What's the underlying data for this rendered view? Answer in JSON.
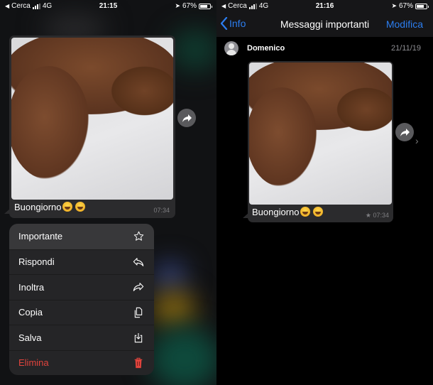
{
  "left": {
    "statusbar": {
      "carrier": "Cerca",
      "network": "4G",
      "time": "21:15",
      "battery": "67%"
    },
    "message": {
      "caption": "Buongiorno",
      "time": "07:34",
      "image": "croissant-photo"
    },
    "context_menu": {
      "items": [
        {
          "label": "Importante",
          "icon": "star-icon"
        },
        {
          "label": "Rispondi",
          "icon": "reply-icon"
        },
        {
          "label": "Inoltra",
          "icon": "forward-icon"
        },
        {
          "label": "Copia",
          "icon": "copy-icon"
        },
        {
          "label": "Salva",
          "icon": "save-icon"
        },
        {
          "label": "Elimina",
          "icon": "trash-icon",
          "destructive": true
        }
      ]
    }
  },
  "right": {
    "statusbar": {
      "carrier": "Cerca",
      "network": "4G",
      "time": "21:16",
      "battery": "67%"
    },
    "navbar": {
      "back_label": "Info",
      "title": "Messaggi importanti",
      "edit_label": "Modifica"
    },
    "sender": {
      "name": "Domenico",
      "date": "21/11/19"
    },
    "message": {
      "caption": "Buongiorno",
      "time": "07:34",
      "starred": true,
      "image": "croissant-photo"
    }
  },
  "colors": {
    "accent": "#2c7ef0",
    "destructive": "#e0443d",
    "bubble": "#2b2b2d"
  }
}
